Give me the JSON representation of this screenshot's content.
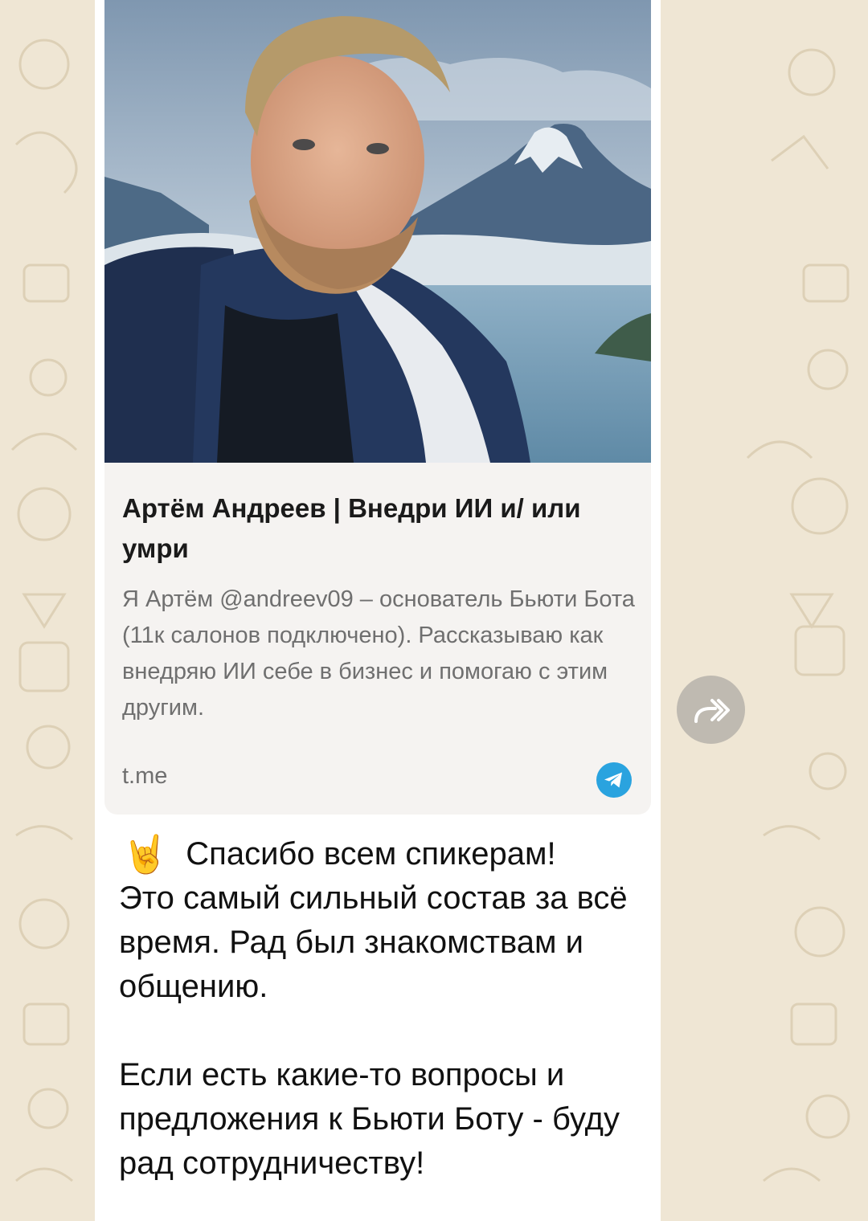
{
  "link_preview": {
    "title": "Артём Андреев | Внедри ИИ и/ или умри",
    "description": "Я Артём @andreev09 – основатель Бьюти Бота (11к салонов подключено). Рассказываю как внедряю ИИ себе в бизнес и помогаю с этим другим.",
    "domain": "t.me",
    "photo_icon": "portrait-photo",
    "source_icon": "telegram-icon"
  },
  "message": {
    "emoji": "🤘",
    "line1": "Спасибо всем спикерам!",
    "line2": "Это самый сильный состав за всё время. Рад был знакомствам и общению.",
    "line3": "Если есть какие-то вопросы и предложения к Бьюти Боту - буду рад сотрудничеству!"
  },
  "actions": {
    "forward_icon": "forward-icon"
  },
  "colors": {
    "wallpaper": "#efe6d4",
    "bubble": "#ffffff",
    "preview_background": "#f5f3f1",
    "telegram_blue": "#2aa3df",
    "forward_button": "#bfbab1"
  }
}
